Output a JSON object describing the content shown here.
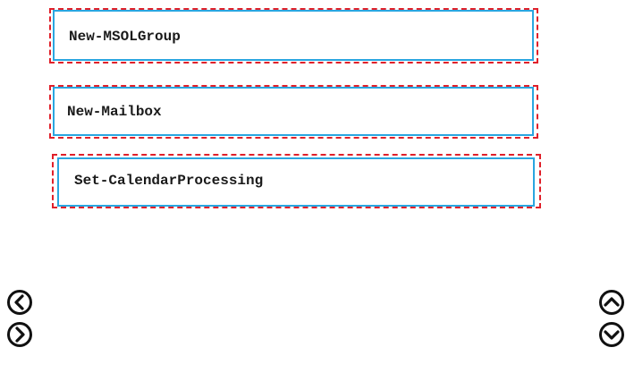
{
  "commands": [
    {
      "label": "New-MSOLGroup"
    },
    {
      "label": "New-Mailbox"
    },
    {
      "label": "Set-CalendarProcessing"
    }
  ],
  "controls": {
    "move_left_icon": "chevron-left-circle",
    "move_right_icon": "chevron-right-circle",
    "move_up_icon": "chevron-up-circle",
    "move_down_icon": "chevron-down-circle"
  },
  "colors": {
    "drop_zone_dash": "#e0202a",
    "item_outline": "#2aa6e0",
    "text": "#1a1a1a"
  }
}
